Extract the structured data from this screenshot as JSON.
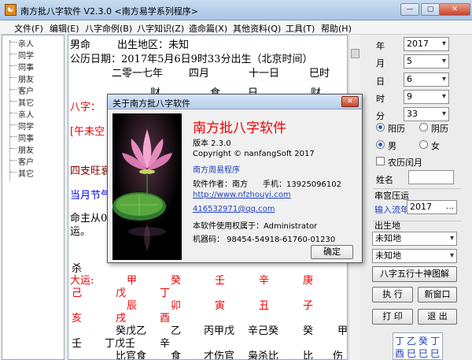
{
  "window": {
    "title": "南方批八字软件 V2.3.0   <南方易学系列程序>",
    "app_icon": "bagua-icon",
    "min_label": "—",
    "max_label": "▢",
    "close_label": "✕"
  },
  "menu": [
    "文件(F)",
    "编辑(E)",
    "八字命例(B)",
    "八字知识(Z)",
    "造命篇(X)",
    "其他资料(Q)",
    "工具(T)",
    "帮助(H)"
  ],
  "relations": [
    "亲人",
    "同学",
    "同事",
    "朋友",
    "客户",
    "其它",
    "亲人",
    "同学",
    "同事",
    "朋友",
    "客户",
    "其它"
  ],
  "chart_text": {
    "line1a": "男命",
    "line1b": "出生地区：未知",
    "line2": "公历日期：2017年5月6日9时33分出生（北京时间）",
    "line3a": "二零一七年",
    "line3b": "四月",
    "line3c": "十一日",
    "line3d": "巳时",
    "line4a": "财",
    "line4b": "食",
    "line4c": "日",
    "line4d": "财",
    "bazi_label": "八字：",
    "wuwei": "[午未空",
    "sizhi": "四支旺衰",
    "dangyue": "当月节气",
    "mingzhu": "命主从0",
    "yun": "运。",
    "sha": "杀",
    "row_yun_label": "大运:",
    "row_yun": [
      "甲",
      "癸",
      "壬",
      "辛",
      "庚"
    ],
    "row_b": [
      "己",
      "戊",
      "丁"
    ],
    "row_c": [
      "辰",
      "卯",
      "寅",
      "丑",
      "子"
    ],
    "row_d": [
      "亥",
      "戌",
      "酉"
    ],
    "row_e": [
      "癸戊乙",
      "乙",
      "丙甲戊",
      "辛己癸",
      "癸",
      "甲"
    ],
    "row_f": [
      "壬",
      "丁戊壬",
      "辛"
    ],
    "row_g": [
      "比官食",
      "食",
      "才伤官",
      "枭杀比",
      "比",
      "伤"
    ]
  },
  "form": {
    "year_label": "年",
    "year_value": "2017",
    "month_label": "月",
    "month_value": "5",
    "day_label": "日",
    "day_value": "6",
    "hour_label": "时",
    "hour_value": "9",
    "minute_label": "分",
    "minute_value": "33",
    "solar_label": "阳历",
    "lunar_label": "阴历",
    "male_label": "男",
    "female_label": "女",
    "leap_label": "农历闰月",
    "name_label": "姓名",
    "name_value": "",
    "panel_label": "串宫压运",
    "enter_year_label": "输入流年",
    "enter_year_value": "2017",
    "birthplace_label": "出生地",
    "place1": "未知地",
    "place2": "未知地",
    "btn_chart": "八字五行十神图解",
    "btn_run": "执 行",
    "btn_new": "新窗口",
    "btn_print": "打 印",
    "btn_exit": "退 出",
    "palace_top": [
      "丁",
      "乙",
      "癸",
      "丁"
    ],
    "palace_bottom": [
      "酉",
      "巳",
      "巳",
      "巳"
    ]
  },
  "dialog": {
    "title": "关于南方批八字软件",
    "app_name": "南方批八字软件",
    "version": "版本 2.3.0",
    "copyright": "Copyright © nanfangSoft 2017",
    "link_program": "南方周易程序",
    "author": "软件作者：南方",
    "phone": "手机：13925096102",
    "website": "http://www.nfzhouyi.com",
    "email": "416532971@qq.com",
    "licensed": "本软件使用权属于：Administrator",
    "machine": "机器码：  98454-54918-61760-01230",
    "ok_label": "确定"
  },
  "colors": {
    "accent_red": "#e00000",
    "link_blue": "#1f3fbf",
    "title_bar": "#b7cde8"
  }
}
